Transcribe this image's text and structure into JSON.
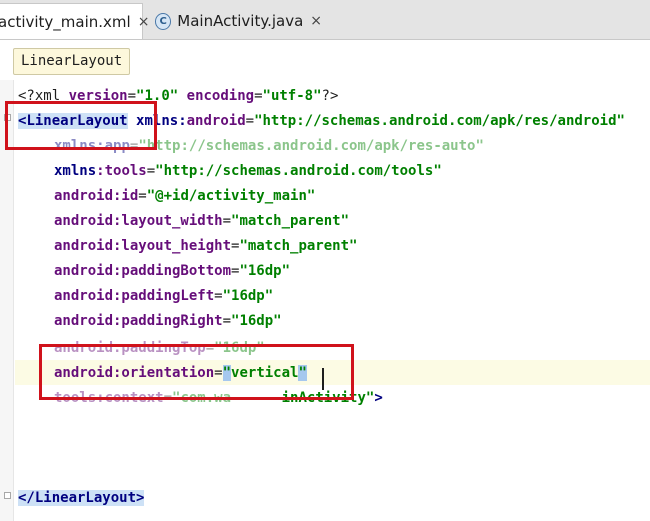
{
  "tabs": [
    {
      "label": "activity_main.xml",
      "close": "×",
      "active": true
    },
    {
      "label": "MainActivity.java",
      "close": "×",
      "icon": "C",
      "active": false
    }
  ],
  "breadcrumb": "LinearLayout",
  "code": {
    "decl": {
      "open": "<?",
      "name": "xml",
      "sp1": " ",
      "a1": "version",
      "eq1": "=",
      "v1": "\"1.0\"",
      "sp2": " ",
      "a2": "encoding",
      "eq2": "=",
      "v2": "\"utf-8\"",
      "close": "?>"
    },
    "root_open": {
      "lt": "<",
      "tag": "LinearLayout",
      "sp": " ",
      "ns": "xmlns",
      "colon": ":",
      "attr": "android",
      "eq": "=",
      "val": "\"http://schemas.android.com/apk/res/android\""
    },
    "attrs": [
      {
        "ns": "xmlns",
        "name": ":app",
        "eq": "=",
        "val": "\"http://schemas.android.com/apk/res-auto\""
      },
      {
        "ns": "xmlns",
        "name": ":tools",
        "eq": "=",
        "val": "\"http://schemas.android.com/tools\""
      },
      {
        "name": "android:id",
        "eq": "=",
        "val": "\"@+id/activity_main\""
      },
      {
        "name": "android:layout_width",
        "eq": "=",
        "val": "\"match_parent\""
      },
      {
        "name": "android:layout_height",
        "eq": "=",
        "val": "\"match_parent\""
      },
      {
        "name": "android:paddingBottom",
        "eq": "=",
        "val": "\"16dp\""
      },
      {
        "name": "android:paddingLeft",
        "eq": "=",
        "val": "\"16dp\""
      },
      {
        "name": "android:paddingRight",
        "eq": "=",
        "val": "\"16dp\""
      },
      {
        "name": "android:paddingTop",
        "eq": "=",
        "val": "\"16dp\""
      },
      {
        "name": "android:orientation",
        "eq": "=",
        "q1": "\"",
        "val": "vertical",
        "q2": "\""
      },
      {
        "name": "tools:context",
        "eq": "=",
        "val": "\"com.wa",
        "tail": "inActivity\"",
        "end": ">"
      }
    ],
    "root_close": {
      "open": "</",
      "tag": "LinearLayout",
      "close": ">"
    }
  },
  "colors": {
    "annotation": "#d0121b",
    "tag": "#000080",
    "attribute": "#660e7a",
    "value": "#008000",
    "selection": "#a6c8ee"
  }
}
